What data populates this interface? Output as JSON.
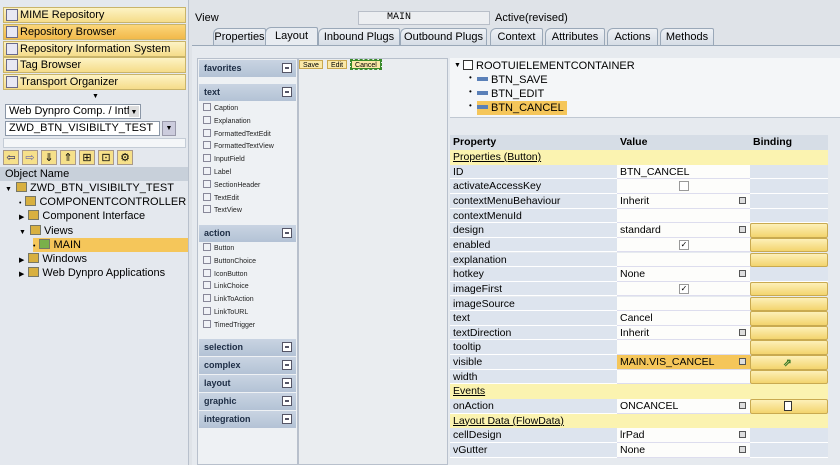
{
  "nav": [
    {
      "label": "MIME Repository",
      "icon": "mime-icon",
      "active": false
    },
    {
      "label": "Repository Browser",
      "icon": "repository-icon",
      "active": true
    },
    {
      "label": "Repository Information System",
      "icon": "info-system-icon",
      "active": false
    },
    {
      "label": "Tag Browser",
      "icon": "tag-icon",
      "active": false
    },
    {
      "label": "Transport Organizer",
      "icon": "truck-icon",
      "active": false
    }
  ],
  "object_type": "Web Dynpro Comp. / Intf.",
  "object_name": "ZWD_BTN_VISIBILTY_TEST",
  "tree_header": "Object Name",
  "tree": [
    {
      "label": "ZWD_BTN_VISIBILTY_TEST",
      "level": 0
    },
    {
      "label": "COMPONENTCONTROLLER",
      "level": 1
    },
    {
      "label": "Component Interface",
      "level": 1
    },
    {
      "label": "Views",
      "level": 1
    },
    {
      "label": "MAIN",
      "level": 2,
      "selected": true
    },
    {
      "label": "Windows",
      "level": 1
    },
    {
      "label": "Web Dynpro Applications",
      "level": 1
    }
  ],
  "view": {
    "label": "View",
    "name": "MAIN",
    "status": "Active(revised)"
  },
  "tabs": [
    "Properties",
    "Layout",
    "Inbound Plugs",
    "Outbound Plugs",
    "Context",
    "Attributes",
    "Actions",
    "Methods"
  ],
  "active_tab": "Layout",
  "palette": {
    "favorites": "favorites",
    "text": "text",
    "text_items": [
      "Caption",
      "Explanation",
      "FormattedTextEdit",
      "FormattedTextView",
      "InputField",
      "Label",
      "SectionHeader",
      "TextEdit",
      "TextView"
    ],
    "action": "action",
    "action_items": [
      "Button",
      "ButtonChoice",
      "IconButton",
      "LinkChoice",
      "LinkToAction",
      "LinkToURL",
      "TimedTrigger"
    ],
    "collapsed": [
      "selection",
      "complex",
      "layout",
      "graphic",
      "integration"
    ]
  },
  "canvas_buttons": [
    "Save",
    "Edit",
    "Cancel"
  ],
  "ui_tree": {
    "root": "ROOTUIELEMENTCONTAINER",
    "children": [
      "BTN_SAVE",
      "BTN_EDIT",
      "BTN_CANCEL"
    ],
    "selected": "BTN_CANCEL"
  },
  "props": {
    "headers": {
      "property": "Property",
      "value": "Value",
      "binding": "Binding"
    },
    "rows": [
      {
        "section": "Properties (Button)"
      },
      {
        "p": "ID",
        "v": "BTN_CANCEL"
      },
      {
        "p": "activateAccessKey",
        "check": false
      },
      {
        "p": "contextMenuBehaviour",
        "v": "Inherit",
        "dd": true
      },
      {
        "p": "contextMenuId",
        "v": ""
      },
      {
        "p": "design",
        "v": "standard",
        "dd": true,
        "bind": true
      },
      {
        "p": "enabled",
        "check": true,
        "bind": true
      },
      {
        "p": "explanation",
        "v": "",
        "bind": true
      },
      {
        "p": "hotkey",
        "v": "None",
        "dd": true
      },
      {
        "p": "imageFirst",
        "check": true,
        "bind": true
      },
      {
        "p": "imageSource",
        "v": "",
        "bind": true
      },
      {
        "p": "text",
        "v": "Cancel",
        "bind": true
      },
      {
        "p": "textDirection",
        "v": "Inherit",
        "dd": true,
        "bind": true
      },
      {
        "p": "tooltip",
        "v": "",
        "bind": true
      },
      {
        "p": "visible",
        "v": "MAIN.VIS_CANCEL",
        "dd": true,
        "bind": true,
        "bound": true
      },
      {
        "p": "width",
        "v": "",
        "bind": true
      },
      {
        "section": "Events"
      },
      {
        "p": "onAction",
        "v": "ONCANCEL",
        "dd": true,
        "bind": true,
        "newdoc": true
      },
      {
        "section": "Layout Data (FlowData)"
      },
      {
        "p": "cellDesign",
        "v": "lrPad",
        "dd": true
      },
      {
        "p": "vGutter",
        "v": "None",
        "dd": true
      }
    ]
  }
}
